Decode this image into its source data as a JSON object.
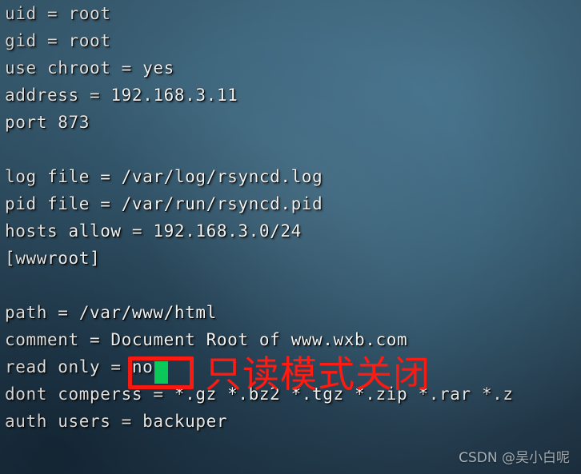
{
  "window": {
    "kind": "terminal-text-editor",
    "background_colors": {
      "top_left": "#3c6278",
      "top_right": "#3a6075",
      "mid": "#32556a",
      "bottom_left": "#21374a",
      "bottom_right": "#253d50"
    }
  },
  "config_file": {
    "lines": [
      {
        "text": "uid = root"
      },
      {
        "text": "gid = root"
      },
      {
        "text": "use chroot = yes"
      },
      {
        "text": "address = 192.168.3.11"
      },
      {
        "text": "port 873"
      },
      {
        "text": ""
      },
      {
        "text": "log file = /var/log/rsyncd.log"
      },
      {
        "text": "pid file = /var/run/rsyncd.pid"
      },
      {
        "text": "hosts allow = 192.168.3.0/24"
      },
      {
        "text": "[wwwroot]"
      },
      {
        "text": ""
      },
      {
        "text": "path = /var/www/html"
      },
      {
        "text": "comment = Document Root of www.wxb.com"
      },
      {
        "text": "read only = no"
      },
      {
        "text": "dont comperss = *.gz *.bz2 *.tgz *.zip *.rar *.z"
      },
      {
        "text": "auth users = backuper"
      }
    ]
  },
  "annotations": {
    "highlight_box": {
      "color": "#ff1b12",
      "target_text": "no"
    },
    "cursor": {
      "color": "#0bcd5c",
      "shape": "block"
    },
    "note": {
      "text": "只读模式关闭",
      "color": "#ff1b12"
    }
  },
  "watermark": {
    "text": "CSDN @吴小白呢"
  }
}
